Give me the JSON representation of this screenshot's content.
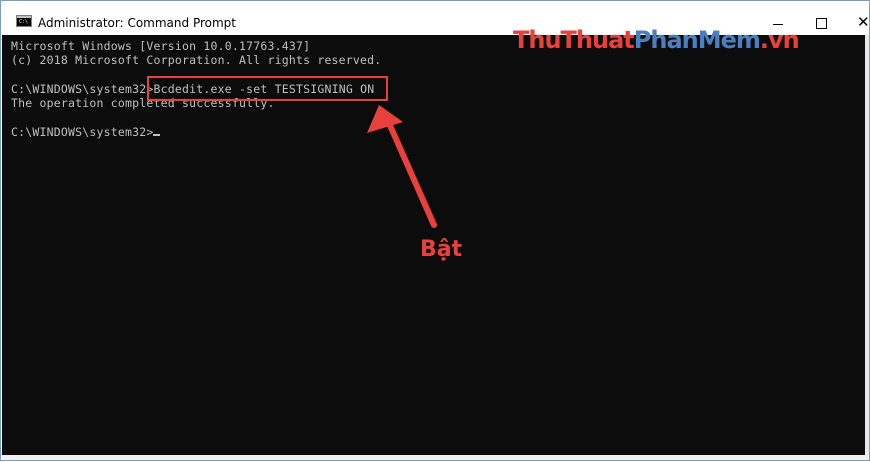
{
  "window": {
    "title": "Administrator: Command Prompt",
    "icon_glyph": "C:\\"
  },
  "controls": {
    "minimize": "minimize-icon",
    "maximize": "maximize-icon",
    "close_glyph": "✕"
  },
  "console": {
    "line1": "Microsoft Windows [Version 10.0.17763.437]",
    "line2": "(c) 2018 Microsoft Corporation. All rights reserved.",
    "line3_prompt": "C:\\WINDOWS\\system32>",
    "line3_command": "Bcdedit.exe -set TESTSIGNING ON",
    "line4": "The operation completed successfully.",
    "line5_prompt": "C:\\WINDOWS\\system32>"
  },
  "annotation": {
    "label": "Bật",
    "color": "#e8413c"
  },
  "watermark": {
    "part1": "ThuThuat",
    "part2": "PhanMem",
    "part3": ".vn"
  },
  "colors": {
    "console_bg": "#0c0c0c",
    "console_text": "#c0c0c0",
    "accent_red": "#e8413c"
  }
}
